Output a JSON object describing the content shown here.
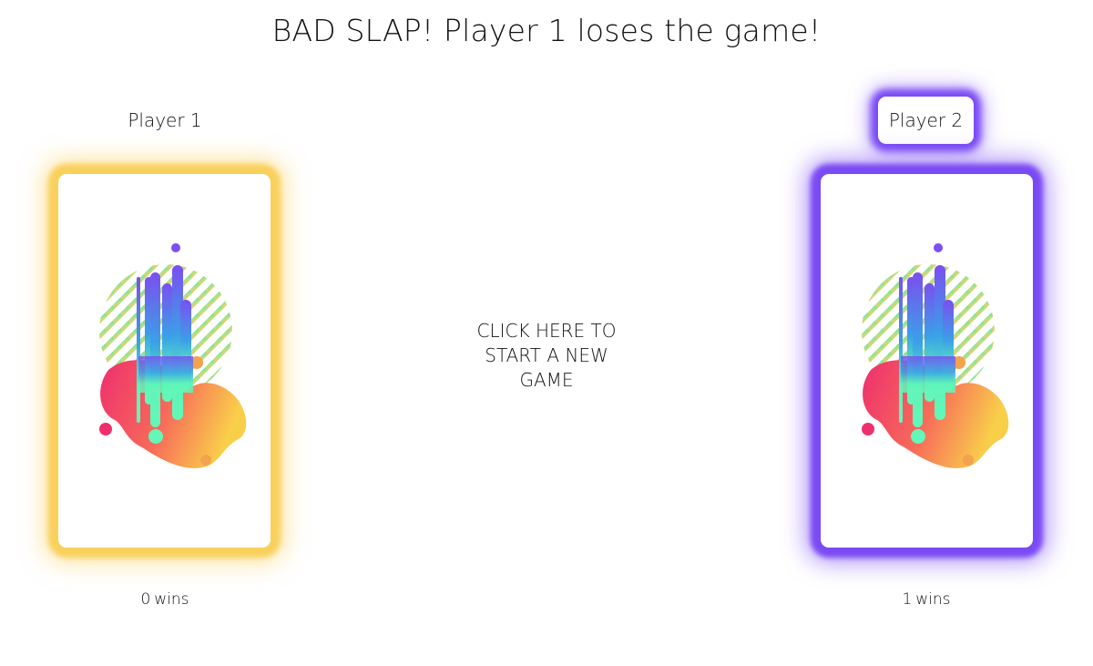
{
  "message": "BAD SLAP! Player 1 loses the game!",
  "new_game": {
    "lines": [
      "CLICK HERE TO",
      "START A NEW",
      "GAME"
    ]
  },
  "players": {
    "p1": {
      "name": "Player 1",
      "wins_count": "0",
      "wins_label": "wins",
      "glow_color": "#fad05d",
      "active": false
    },
    "p2": {
      "name": "Player 2",
      "wins_count": "1",
      "wins_label": "wins",
      "glow_color": "#7a4af4",
      "active": true
    }
  },
  "card_art": "abstract-splash-card-back"
}
